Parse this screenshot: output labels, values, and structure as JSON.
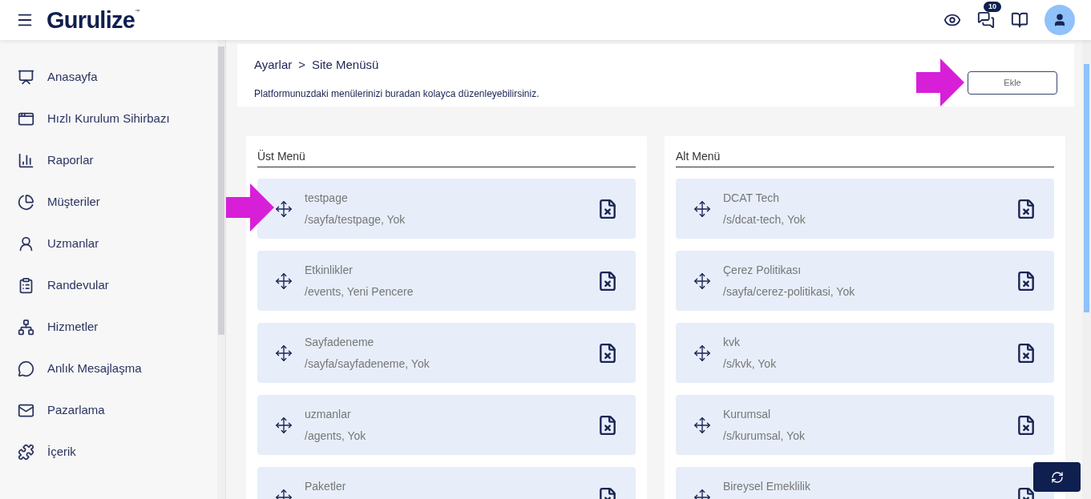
{
  "header": {
    "logo": "Gurulize",
    "logo_mark": "™",
    "notification_count": "10"
  },
  "sidebar": {
    "items": [
      {
        "label": "Anasayfa"
      },
      {
        "label": "Hızlı Kurulum Sihirbazı"
      },
      {
        "label": "Raporlar"
      },
      {
        "label": "Müşteriler"
      },
      {
        "label": "Uzmanlar"
      },
      {
        "label": "Randevular"
      },
      {
        "label": "Hizmetler"
      },
      {
        "label": "Anlık Mesajlaşma"
      },
      {
        "label": "Pazarlama"
      },
      {
        "label": "İçerik"
      }
    ]
  },
  "breadcrumb": [
    "Ayarlar",
    "Site Menüsü"
  ],
  "breadcrumb_separator": ">",
  "description": "Platformunuzdaki menülerinizi buradan kolayca düzenleyebilirsiniz.",
  "add_button": "Ekle",
  "menus": [
    {
      "title": "Üst Menü",
      "items": [
        {
          "name": "testpage",
          "detail": "/sayfa/testpage, Yok"
        },
        {
          "name": "Etkinlikler",
          "detail": "/events, Yeni Pencere"
        },
        {
          "name": "Sayfadeneme",
          "detail": "/sayfa/sayfadeneme, Yok"
        },
        {
          "name": "uzmanlar",
          "detail": "/agents, Yok"
        },
        {
          "name": "Paketler"
        }
      ]
    },
    {
      "title": "Alt Menü",
      "items": [
        {
          "name": "DCAT Tech",
          "detail": "/s/dcat-tech, Yok"
        },
        {
          "name": "Çerez Politikası",
          "detail": "/sayfa/cerez-politikasi, Yok"
        },
        {
          "name": "kvk",
          "detail": "/s/kvk, Yok"
        },
        {
          "name": "Kurumsal",
          "detail": "/s/kurumsal, Yok"
        },
        {
          "name": "Bireysel Emeklilik"
        }
      ]
    }
  ]
}
